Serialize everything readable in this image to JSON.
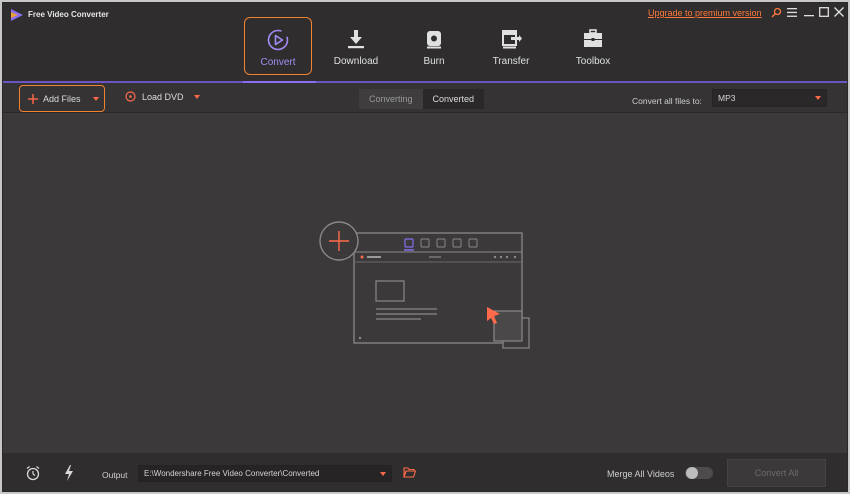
{
  "app": {
    "title": "Free Video Converter",
    "upgrade_link": "Upgrade to premium version"
  },
  "nav": {
    "tabs": [
      {
        "label": "Convert",
        "icon": "convert-icon",
        "active": true
      },
      {
        "label": "Download",
        "icon": "download-icon",
        "active": false
      },
      {
        "label": "Burn",
        "icon": "burn-icon",
        "active": false
      },
      {
        "label": "Transfer",
        "icon": "transfer-icon",
        "active": false
      },
      {
        "label": "Toolbox",
        "icon": "toolbox-icon",
        "active": false
      }
    ]
  },
  "toolbar": {
    "add_files": "Add Files",
    "load_dvd": "Load DVD",
    "seg_converting": "Converting",
    "seg_converted": "Converted",
    "convert_all_to_label": "Convert all files to:",
    "format_value": "MP3"
  },
  "bottom": {
    "output_label": "Output",
    "output_path": "E:\\Wondershare Free Video Converter\\Converted",
    "merge_label": "Merge All Videos",
    "merge_enabled": false,
    "convert_all": "Convert All"
  },
  "colors": {
    "accent_orange": "#f08232",
    "accent_purple": "#8a6df0",
    "background": "#3b393a",
    "titlebar": "#2f2d2e"
  }
}
